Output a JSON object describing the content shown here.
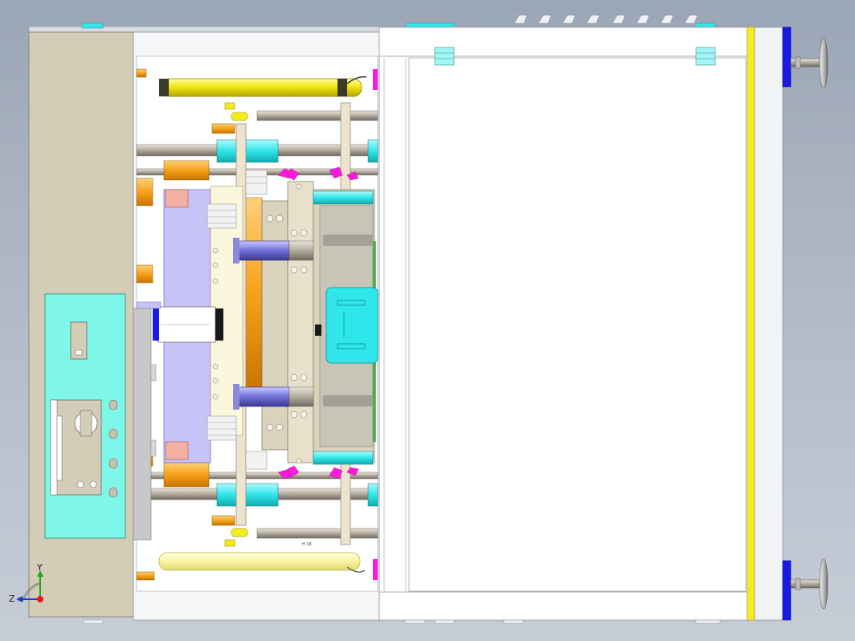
{
  "viewport": {
    "background_top": "#9ba6b6",
    "background_bottom": "#c7cdd7"
  },
  "view_triad": {
    "y_label": "Y",
    "z_label": "Z",
    "colors": {
      "y_axis": "#1aa81a",
      "z_axis": "#1a3ad6",
      "origin": "#e01a1a"
    }
  },
  "part_label": "H 18",
  "palette": {
    "frame": "#d3cdb8",
    "panel": "#7ff7e8",
    "plate": "#c6c3f7",
    "orange": "#f5a21a",
    "cyan": "#2fe6ea",
    "yellow": "#f5ec1a",
    "magenta": "#ff1adb",
    "navy": "#1a1ae6",
    "rod": "#b8b0a2",
    "pink": "#f4b0a4",
    "white": "#ffffff"
  }
}
